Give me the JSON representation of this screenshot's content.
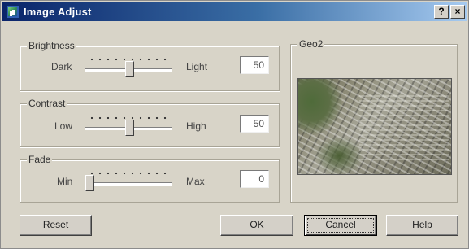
{
  "window": {
    "title": "Image Adjust",
    "help_button": "?",
    "close_button": "×",
    "app_icon": "image-adjust-app-icon"
  },
  "brightness": {
    "legend": "Brightness",
    "min_label": "Dark",
    "max_label": "Light",
    "value": "50",
    "level": 0.5
  },
  "contrast": {
    "legend": "Contrast",
    "min_label": "Low",
    "max_label": "High",
    "value": "50",
    "level": 0.5
  },
  "fade": {
    "legend": "Fade",
    "min_label": "Min",
    "max_label": "Max",
    "value": "0",
    "level": 0.0
  },
  "preview": {
    "legend": "Geo2",
    "image": "aerial-city-photo"
  },
  "buttons": {
    "reset_first": "R",
    "reset_rest": "eset",
    "ok": "OK",
    "cancel": "Cancel",
    "help_first": "H",
    "help_rest": "elp"
  }
}
